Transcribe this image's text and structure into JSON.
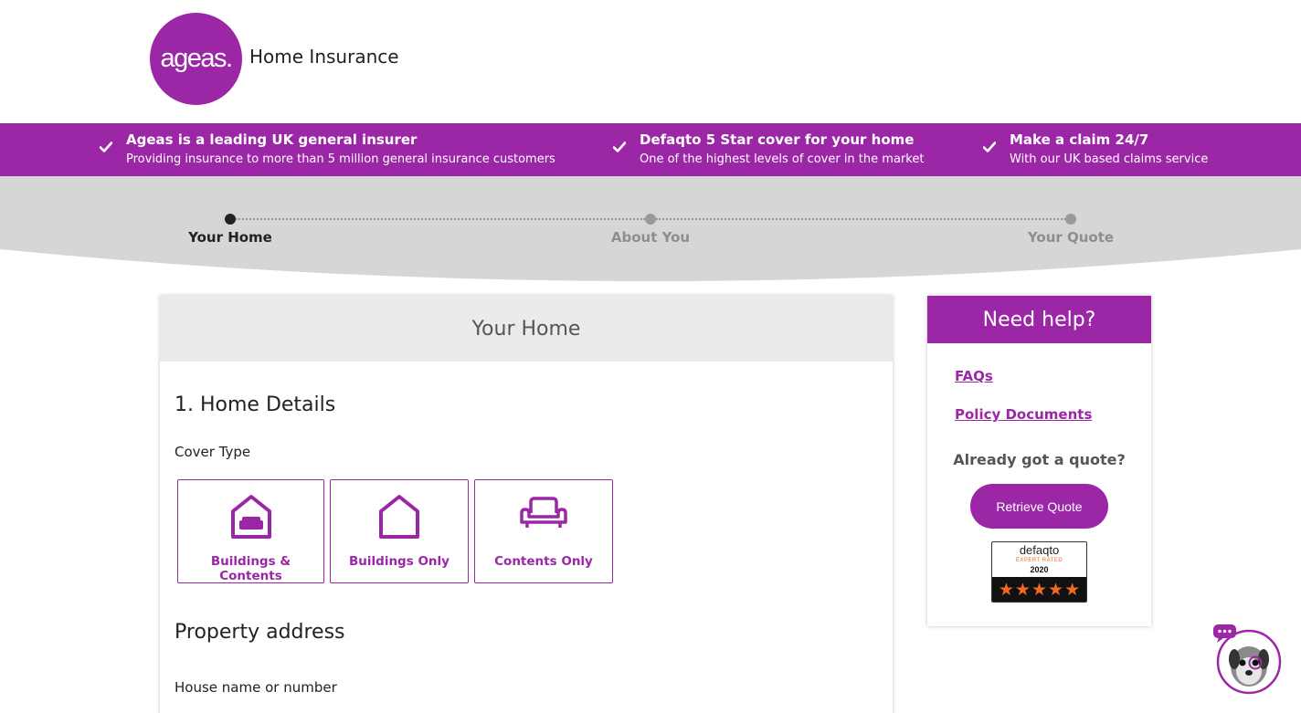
{
  "header": {
    "logo_text": "ageas.",
    "brand_title": "Home Insurance"
  },
  "benefits": [
    {
      "title": "Ageas is a leading UK general insurer",
      "subtitle": "Providing insurance to more than 5 million general insurance customers"
    },
    {
      "title": "Defaqto 5 Star cover for your home",
      "subtitle": "One of the highest levels of cover in the market"
    },
    {
      "title": "Make a claim 24/7",
      "subtitle": "With our UK based claims service"
    }
  ],
  "steps": [
    {
      "label": "Your Home",
      "state": "active"
    },
    {
      "label": "About You",
      "state": "inactive"
    },
    {
      "label": "Your Quote",
      "state": "inactive"
    }
  ],
  "card": {
    "heading": "Your Home",
    "section_title": "1. Home Details",
    "cover_type_label": "Cover Type",
    "cover_options": [
      {
        "label": "Buildings & Contents",
        "icon": "house-with-sofa-icon"
      },
      {
        "label": "Buildings Only",
        "icon": "house-icon"
      },
      {
        "label": "Contents Only",
        "icon": "armchair-icon"
      }
    ],
    "address_title": "Property address",
    "house_label": "House name or number"
  },
  "help": {
    "heading": "Need help?",
    "links": [
      "FAQs",
      "Policy Documents"
    ],
    "already_quote": "Already got a quote?",
    "retrieve_button": "Retrieve Quote",
    "badge": {
      "brand": "defaqto",
      "rated": "EXPERT RATED",
      "year": "2020",
      "stars": 5
    }
  },
  "colors": {
    "brand_purple": "#9b27a6",
    "star_orange": "#f26a21",
    "stepper_grey": "#d6d6d6"
  }
}
